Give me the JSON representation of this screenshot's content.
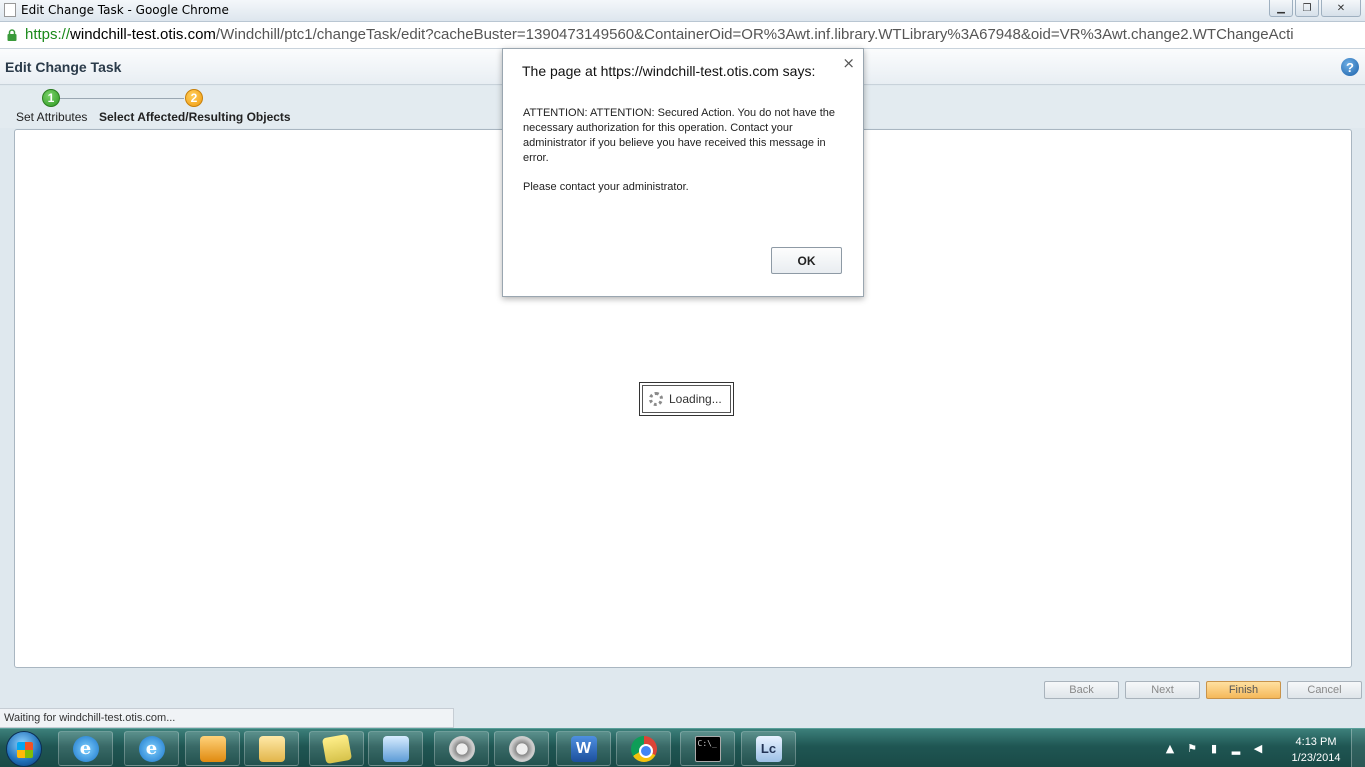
{
  "window": {
    "title": "Edit Change Task - Google Chrome",
    "minimize_label": "▁",
    "maximize_label": "❐",
    "close_label": "✕"
  },
  "address": {
    "scheme": "https://",
    "host": "windchill-test.otis.com",
    "path": "/Windchill/ptc1/changeTask/edit?cacheBuster=1390473149560&ContainerOid=OR%3Awt.inf.library.WTLibrary%3A67948&oid=VR%3Awt.change2.WTChangeActi"
  },
  "app": {
    "title": "Edit Change Task",
    "help_label": "?"
  },
  "wizard": {
    "steps": [
      {
        "number": "1",
        "label": "Set Attributes"
      },
      {
        "number": "2",
        "label": "Select Affected/Resulting Objects"
      }
    ],
    "loading_text": "Loading...",
    "buttons": {
      "back": "Back",
      "next": "Next",
      "finish": "Finish",
      "cancel": "Cancel"
    }
  },
  "status_bar": "Waiting for windchill-test.otis.com...",
  "dialog": {
    "title": "The page at https://windchill-test.otis.com says:",
    "close_label": "×",
    "message": "ATTENTION: ATTENTION:  Secured Action. You do not have the necessary authorization for this operation. Contact your administrator if you believe you have received this message in error.",
    "message2": "Please contact your administrator.",
    "ok_label": "OK"
  },
  "taskbar": {
    "ie_label": "e",
    "word_label": "W",
    "cmd_label": "C:\\_",
    "lc_label": "Lc",
    "clock_time": "4:13 PM",
    "clock_date": "1/23/2014"
  }
}
